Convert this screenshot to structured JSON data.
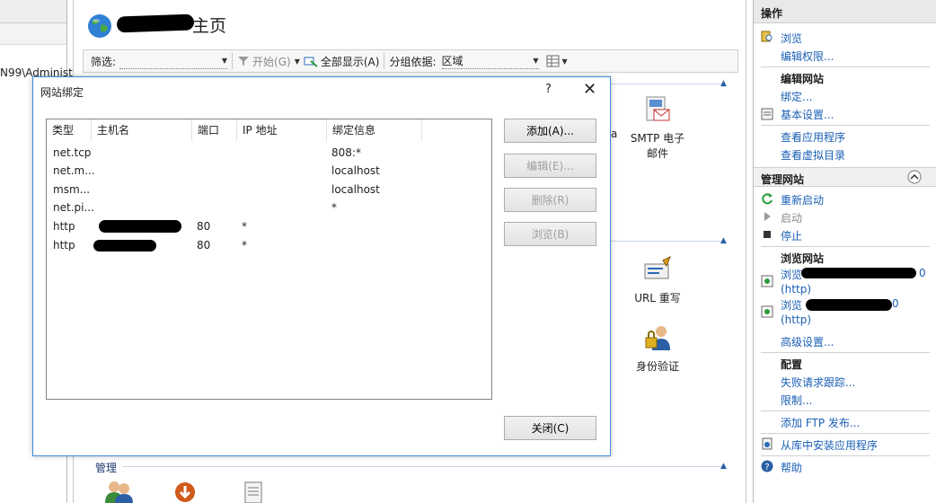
{
  "left": {
    "node_text": "N99\\Administ"
  },
  "center": {
    "title": "主页",
    "filter_label": "筛选:",
    "start_label": "开始(G)",
    "show_all_label": "全部显示(A)",
    "group_by_label": "分组依据:",
    "group_by_value": "区域",
    "features": [
      {
        "label": "SMTP 电子\n邮件"
      },
      {
        "label": "URL 重写"
      },
      {
        "label": "身份验证"
      }
    ],
    "partial_text": "a",
    "manage_group": "管理"
  },
  "dialog": {
    "title": "网站绑定",
    "help": "?",
    "columns": [
      "类型",
      "主机名",
      "端口",
      "IP 地址",
      "绑定信息"
    ],
    "rows": [
      {
        "type": "net.tcp",
        "port": "",
        "ip": "",
        "info": "808:*"
      },
      {
        "type": "net.m...",
        "port": "",
        "ip": "",
        "info": "localhost"
      },
      {
        "type": "msm...",
        "port": "",
        "ip": "",
        "info": "localhost"
      },
      {
        "type": "net.pi...",
        "port": "",
        "ip": "",
        "info": "*"
      },
      {
        "type": "http",
        "port": "80",
        "ip": "*",
        "info": ""
      },
      {
        "type": "http",
        "port": "80",
        "ip": "*",
        "info": ""
      }
    ],
    "buttons": {
      "add": "添加(A)...",
      "edit": "编辑(E)...",
      "remove": "删除(R)",
      "browse": "浏览(B)",
      "close": "关闭(C)"
    }
  },
  "actions": {
    "title": "操作",
    "browse": "浏览",
    "edit_permissions": "编辑权限...",
    "edit_site": "编辑网站",
    "bindings": "绑定...",
    "basic_settings": "基本设置...",
    "view_apps": "查看应用程序",
    "view_vdirs": "查看虚拟目录",
    "manage_site": "管理网站",
    "restart": "重新启动",
    "start": "启动",
    "stop": "停止",
    "browse_site": "浏览网站",
    "browse_1": "浏览",
    "browse_1_suffix": "0",
    "browse_1_proto": "(http)",
    "browse_2": "浏览",
    "browse_2_suffix": "0",
    "browse_2_proto": "(http)",
    "advanced": "高级设置...",
    "config": "配置",
    "failed_req": "失败请求跟踪...",
    "limits": "限制...",
    "add_ftp": "添加 FTP 发布...",
    "install_from_gallery": "从库中安装应用程序",
    "help": "帮助"
  }
}
